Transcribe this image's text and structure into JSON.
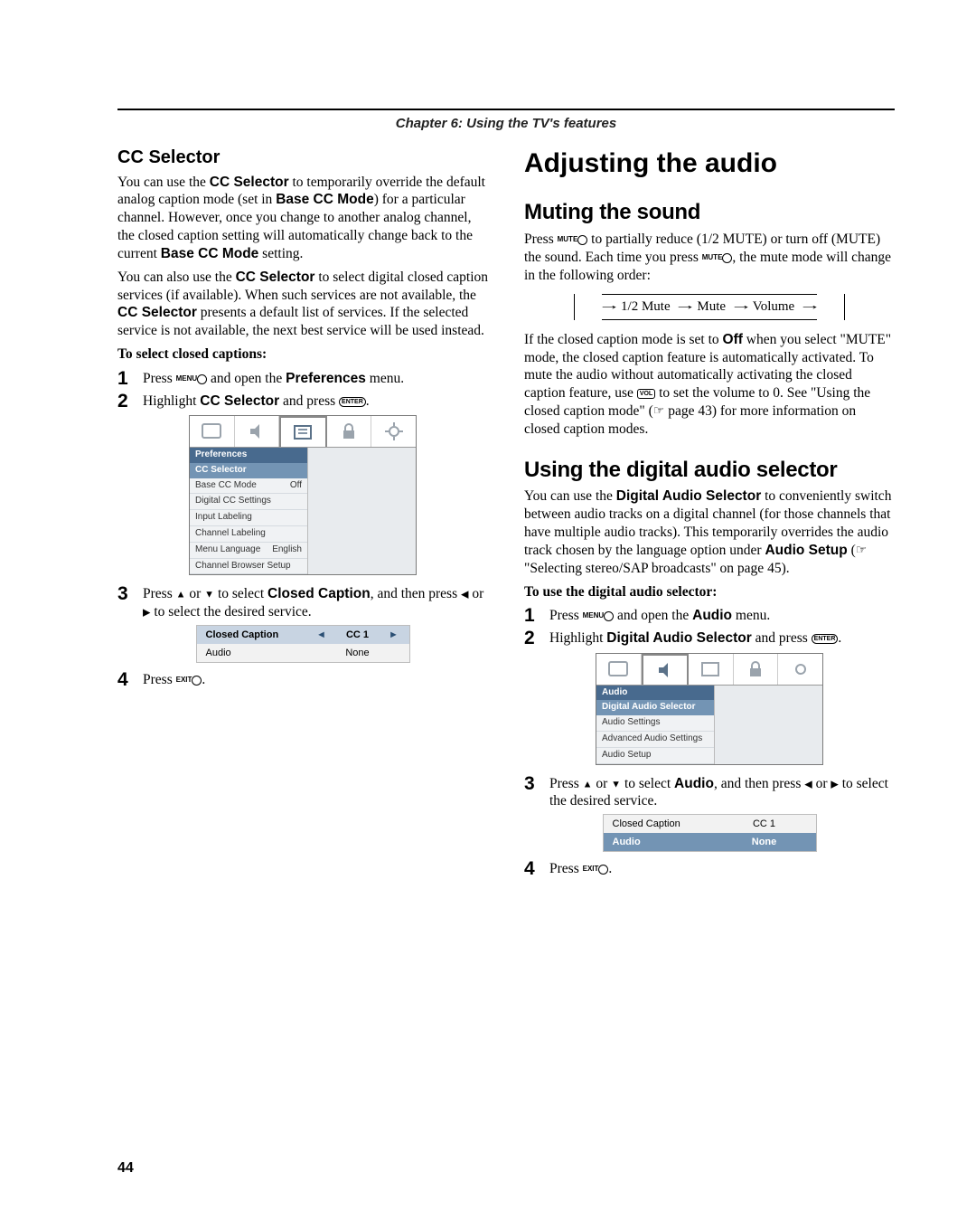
{
  "chapter": {
    "title": "Chapter 6: Using the TV's features"
  },
  "left": {
    "h_sub": "CC Selector",
    "p1a": "You can use the ",
    "p1_cc": "CC Selector",
    "p1b": " to temporarily override the default analog caption mode (set in ",
    "p1_base": "Base CC Mode",
    "p1c": ") for a particular channel. However, once you change to another analog channel, the closed caption setting will automatically change back to the current ",
    "p1_base2": "Base CC Mode",
    "p1d": " setting.",
    "p2a": "You can also use the ",
    "p2_cc": "CC Selector",
    "p2b": " to select digital closed caption services (if available). When such services are not available, the ",
    "p2_cc2": "CC Selector",
    "p2c": " presents a default list of services. If the selected service is not available, the next best service will be used instead.",
    "to_select": "To select closed captions:",
    "step1a": "Press ",
    "menu_label": "MENU",
    "step1b": " and open the ",
    "step1_pref": "Preferences",
    "step1c": " menu.",
    "step2a": "Highlight ",
    "step2_cc": "CC Selector",
    "step2b": " and press ",
    "enter": "ENTER",
    "menu": {
      "title": "Preferences",
      "sel": "CC Selector",
      "rows": [
        {
          "l": "Base CC Mode",
          "r": "Off"
        },
        {
          "l": "Digital CC Settings",
          "r": ""
        },
        {
          "l": "Input Labeling",
          "r": ""
        },
        {
          "l": "Channel Labeling",
          "r": ""
        },
        {
          "l": "Menu Language",
          "r": "English"
        },
        {
          "l": "Channel Browser Setup",
          "r": ""
        }
      ]
    },
    "step3a": "Press ",
    "step3b": " or ",
    "step3c": " to select ",
    "step3_cc": "Closed Caption",
    "step3d": ", and then press ",
    "step3e": " or ",
    "step3f": " to select the desired service.",
    "minisel": {
      "r1": {
        "label": "Closed Caption",
        "val": "CC 1"
      },
      "r2": {
        "label": "Audio",
        "val": "None"
      }
    },
    "step4a": "Press ",
    "exit_label": "EXIT",
    "step4b": "."
  },
  "right": {
    "h_main": "Adjusting the audio",
    "h_mute": "Muting the sound",
    "mute_label": "MUTE",
    "p1a": "Press ",
    "p1b": " to partially reduce (1/2 MUTE) or turn off (MUTE) the sound. Each time you press ",
    "p1c": ", the mute mode will change in the following order:",
    "flow": {
      "a": "1/2 Mute",
      "b": "Mute",
      "c": "Volume"
    },
    "p2a": "If the closed caption mode is set to ",
    "p2_off": "Off",
    "p2b": " when you select \"MUTE\" mode, the closed caption feature is automatically activated. To mute the audio without automatically activating the closed caption feature, use ",
    "vol": "VOL",
    "p2c": " to set the volume to 0. See \"Using the closed caption mode\" (",
    "p2_page": " page 43) for more information on closed caption modes.",
    "h_das": "Using the digital audio selector",
    "p3a": "You can use the ",
    "p3_das": "Digital Audio Selector",
    "p3b": " to conveniently switch between audio tracks on a digital channel (for those channels that have multiple audio tracks). This temporarily overrides the audio track chosen by the language option under ",
    "p3_as": "Audio Setup",
    "p3c": " (",
    "p3d": " \"Selecting stereo/SAP broadcasts\" on page 45).",
    "to_use": "To use the digital audio selector:",
    "step1a": "Press ",
    "menu_label": "MENU",
    "step1b": " and open the ",
    "step1_audio": "Audio",
    "step1c": " menu.",
    "step2a": "Highlight ",
    "step2_das": "Digital Audio Selector",
    "step2b": " and press ",
    "enter": "ENTER",
    "menu": {
      "title": "Audio",
      "sel": "Digital Audio Selector",
      "rows": [
        {
          "l": "Audio Settings",
          "r": ""
        },
        {
          "l": "Advanced Audio Settings",
          "r": ""
        },
        {
          "l": "Audio Setup",
          "r": ""
        }
      ]
    },
    "step3a": "Press ",
    "step3b": " or ",
    "step3c": " to select ",
    "step3_audio": "Audio",
    "step3d": ", and then press ",
    "step3e": " or ",
    "step3f": " to select the desired service.",
    "minisel": {
      "r1": {
        "label": "Closed Caption",
        "val": "CC 1"
      },
      "r2": {
        "label": "Audio",
        "val": "None"
      }
    },
    "step4a": "Press ",
    "exit_label": "EXIT",
    "step4b": "."
  },
  "page_number": "44"
}
